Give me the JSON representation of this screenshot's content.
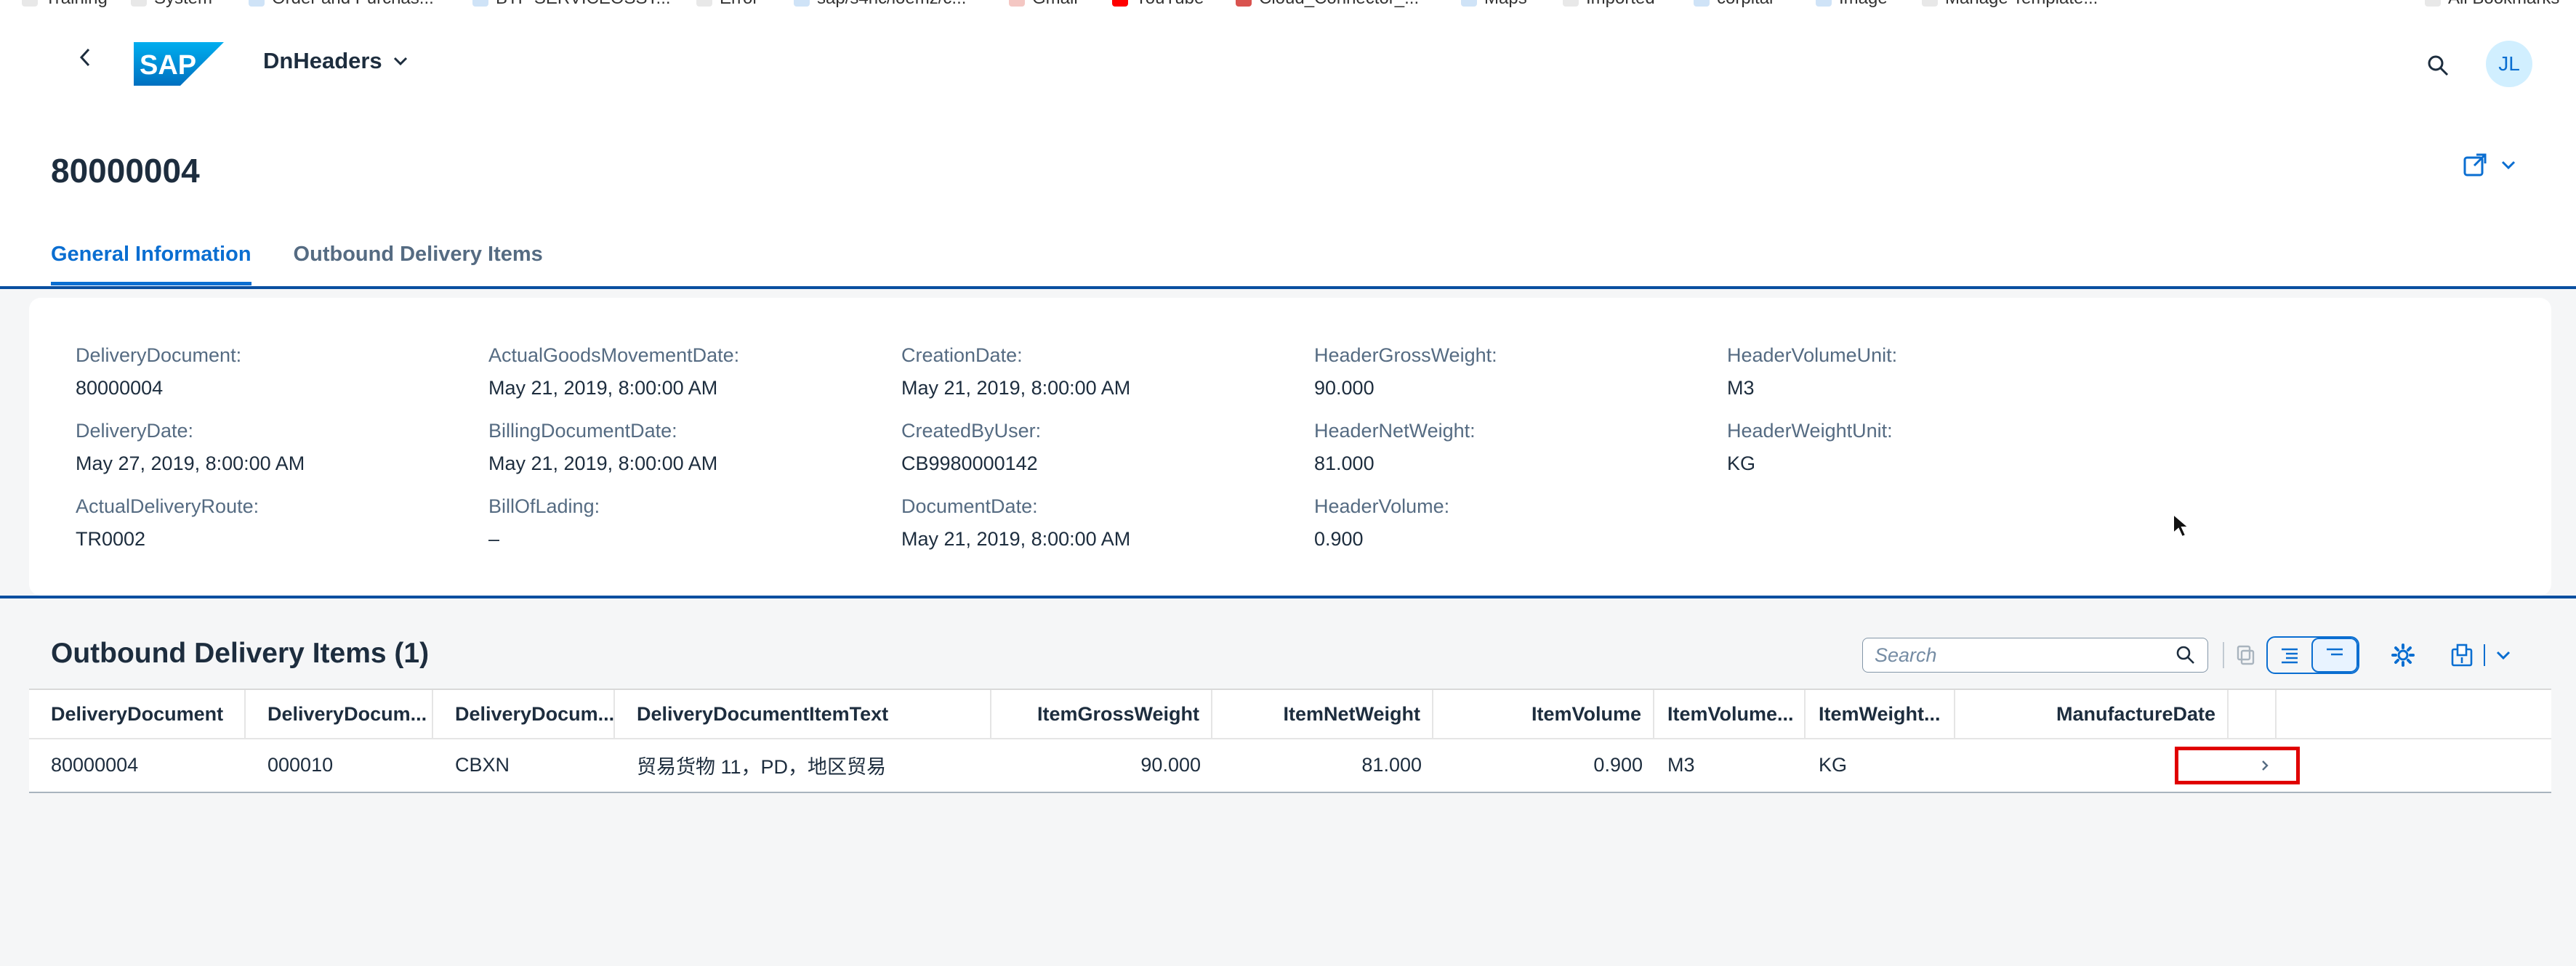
{
  "bookmarks": [
    "Training",
    "System",
    "Order and Purchas...",
    "BTP SERVICEOSST...",
    "Error",
    "sap/s4hc/loemz/c...",
    "Gmail",
    "YouTube",
    "Cloud_Connector_...",
    "Maps",
    "Imported",
    "corpital",
    "Image",
    "Manage Template...",
    "All Bookmarks"
  ],
  "shell": {
    "app_title": "DnHeaders",
    "avatar_initials": "JL"
  },
  "header": {
    "object_title": "80000004",
    "tabs": [
      "General Information",
      "Outbound Delivery Items"
    ]
  },
  "general_info": {
    "fields": [
      {
        "label": "DeliveryDocument:",
        "value": "80000004"
      },
      {
        "label": "DeliveryDate:",
        "value": "May 27, 2019, 8:00:00 AM"
      },
      {
        "label": "ActualDeliveryRoute:",
        "value": "TR0002"
      },
      {
        "label": "ActualGoodsMovementDate:",
        "value": "May 21, 2019, 8:00:00 AM"
      },
      {
        "label": "BillingDocumentDate:",
        "value": "May 21, 2019, 8:00:00 AM"
      },
      {
        "label": "BillOfLading:",
        "value": "–"
      },
      {
        "label": "CreationDate:",
        "value": "May 21, 2019, 8:00:00 AM"
      },
      {
        "label": "CreatedByUser:",
        "value": "CB9980000142"
      },
      {
        "label": "DocumentDate:",
        "value": "May 21, 2019, 8:00:00 AM"
      },
      {
        "label": "HeaderGrossWeight:",
        "value": "90.000"
      },
      {
        "label": "HeaderNetWeight:",
        "value": "81.000"
      },
      {
        "label": "HeaderVolume:",
        "value": "0.900"
      },
      {
        "label": "HeaderVolumeUnit:",
        "value": "M3"
      },
      {
        "label": "HeaderWeightUnit:",
        "value": "KG"
      }
    ]
  },
  "items_table": {
    "title": "Outbound Delivery Items (1)",
    "search_placeholder": "Search",
    "columns": [
      "DeliveryDocument",
      "DeliveryDocum...",
      "DeliveryDocum...",
      "DeliveryDocumentItemText",
      "ItemGrossWeight",
      "ItemNetWeight",
      "ItemVolume",
      "ItemVolume...",
      "ItemWeight...",
      "ManufactureDate"
    ],
    "rows": [
      [
        "80000004",
        "000010",
        "CBXN",
        "贸易货物 11，PD，地区贸易",
        "90.000",
        "81.000",
        "0.900",
        "M3",
        "KG",
        ""
      ]
    ]
  },
  "colors": {
    "accent": "#0a6ed1",
    "section_line": "#0a4fa0",
    "highlight": "#e00000"
  }
}
